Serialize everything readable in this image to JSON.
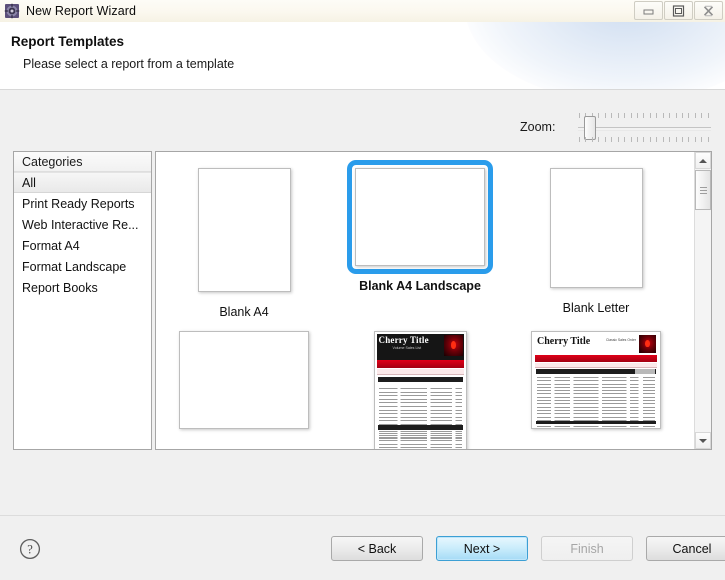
{
  "window": {
    "title": "New Report Wizard",
    "icon": "gear-icon",
    "buttons": {
      "minimize": "minimize-icon",
      "maximize": "maximize-icon",
      "close": "close-icon"
    }
  },
  "header": {
    "title": "Report Templates",
    "subtitle": "Please select a report from a template"
  },
  "zoom": {
    "label": "Zoom:",
    "value": 10,
    "min": 0,
    "max": 100,
    "tick_count": 21
  },
  "categories": {
    "header": "Categories",
    "selected": "All",
    "items": [
      {
        "label": "All",
        "selected": true
      },
      {
        "label": "Print Ready Reports",
        "selected": false
      },
      {
        "label": "Web Interactive Re...",
        "selected": false
      },
      {
        "label": "Format A4",
        "selected": false
      },
      {
        "label": "Format Landscape",
        "selected": false
      },
      {
        "label": "Report Books",
        "selected": false
      }
    ]
  },
  "templates": {
    "rows": [
      [
        {
          "label": "Blank A4",
          "kind": "blank-portrait",
          "selected": false
        },
        {
          "label": "Blank A4 Landscape",
          "kind": "blank-landscape",
          "selected": true
        },
        {
          "label": "Blank Letter",
          "kind": "blank-letter",
          "selected": false
        }
      ],
      [
        {
          "label": "",
          "kind": "blank-landscape",
          "selected": false
        },
        {
          "label": "",
          "kind": "cherry-portrait",
          "selected": false,
          "report_title": "Cherry Title",
          "report_subtitle": "Volume Sales List"
        },
        {
          "label": "",
          "kind": "cherry-landscape",
          "selected": false,
          "report_title": "Cherry Title",
          "report_subtitle": "Classic Sales Order"
        }
      ]
    ],
    "selection_color": "#2a9ceb"
  },
  "scrollbar": {
    "up": "scroll-up-icon",
    "down": "scroll-down-icon",
    "thumb_position": "near-top"
  },
  "footer": {
    "help": "help-icon",
    "buttons": [
      {
        "label": "< Back",
        "state": "normal",
        "name": "back-button"
      },
      {
        "label": "Next >",
        "state": "focused",
        "name": "next-button"
      },
      {
        "label": "Finish",
        "state": "disabled",
        "name": "finish-button"
      },
      {
        "label": "Cancel",
        "state": "normal",
        "name": "cancel-button"
      }
    ]
  }
}
